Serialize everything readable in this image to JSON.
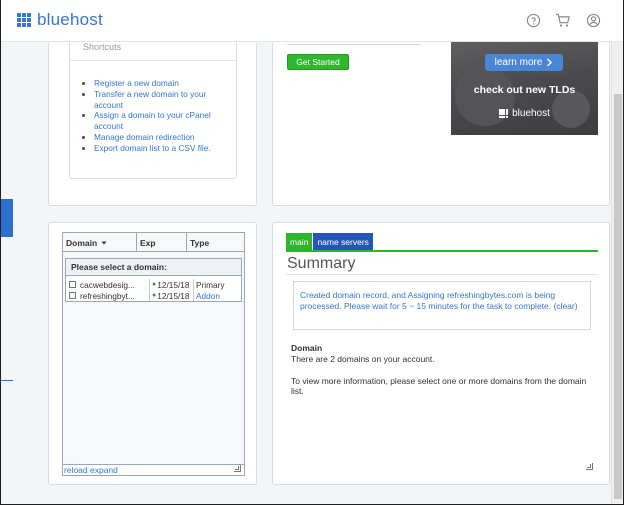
{
  "header": {
    "brand": "bluehost",
    "icons": [
      "help-icon",
      "cart-icon",
      "user-icon"
    ]
  },
  "shortcuts": {
    "title": "Shortcuts",
    "items": [
      "Register a new domain",
      "Transfer a new domain to your account",
      "Assign a domain to your cPanel account",
      "Manage domain redirection",
      "Export domain list to a CSV file."
    ]
  },
  "promo": {
    "get_started": "Get Started",
    "learn_more": "learn more",
    "tagline": "check out new TLDs",
    "brand": "bluehost"
  },
  "domains": {
    "columns": [
      "Domain",
      "Exp",
      "Type"
    ],
    "select_title": "Please select a domain:",
    "rows": [
      {
        "domain": "cacwebdesig...",
        "exp": "12/15/18",
        "type": "Primary"
      },
      {
        "domain": "refreshingbyt...",
        "exp": "12/15/18",
        "type": "Addon"
      }
    ],
    "footer": "reload expand"
  },
  "summary": {
    "tabs": [
      "main",
      "name servers"
    ],
    "title": "Summary",
    "notice": "Created domain record, and Assigning refreshingbytes.com is being processed. Please wait for 5 ~ 15 minutes for the task to complete. (clear)",
    "domain_label": "Domain",
    "domain_count_text": "There are 2 domains on your account.",
    "more_info": "To view more information, please select one or more domains from the domain list."
  },
  "colors": {
    "brand_blue": "#3575d3",
    "green": "#2db52d",
    "tab_blue": "#2456b7"
  }
}
